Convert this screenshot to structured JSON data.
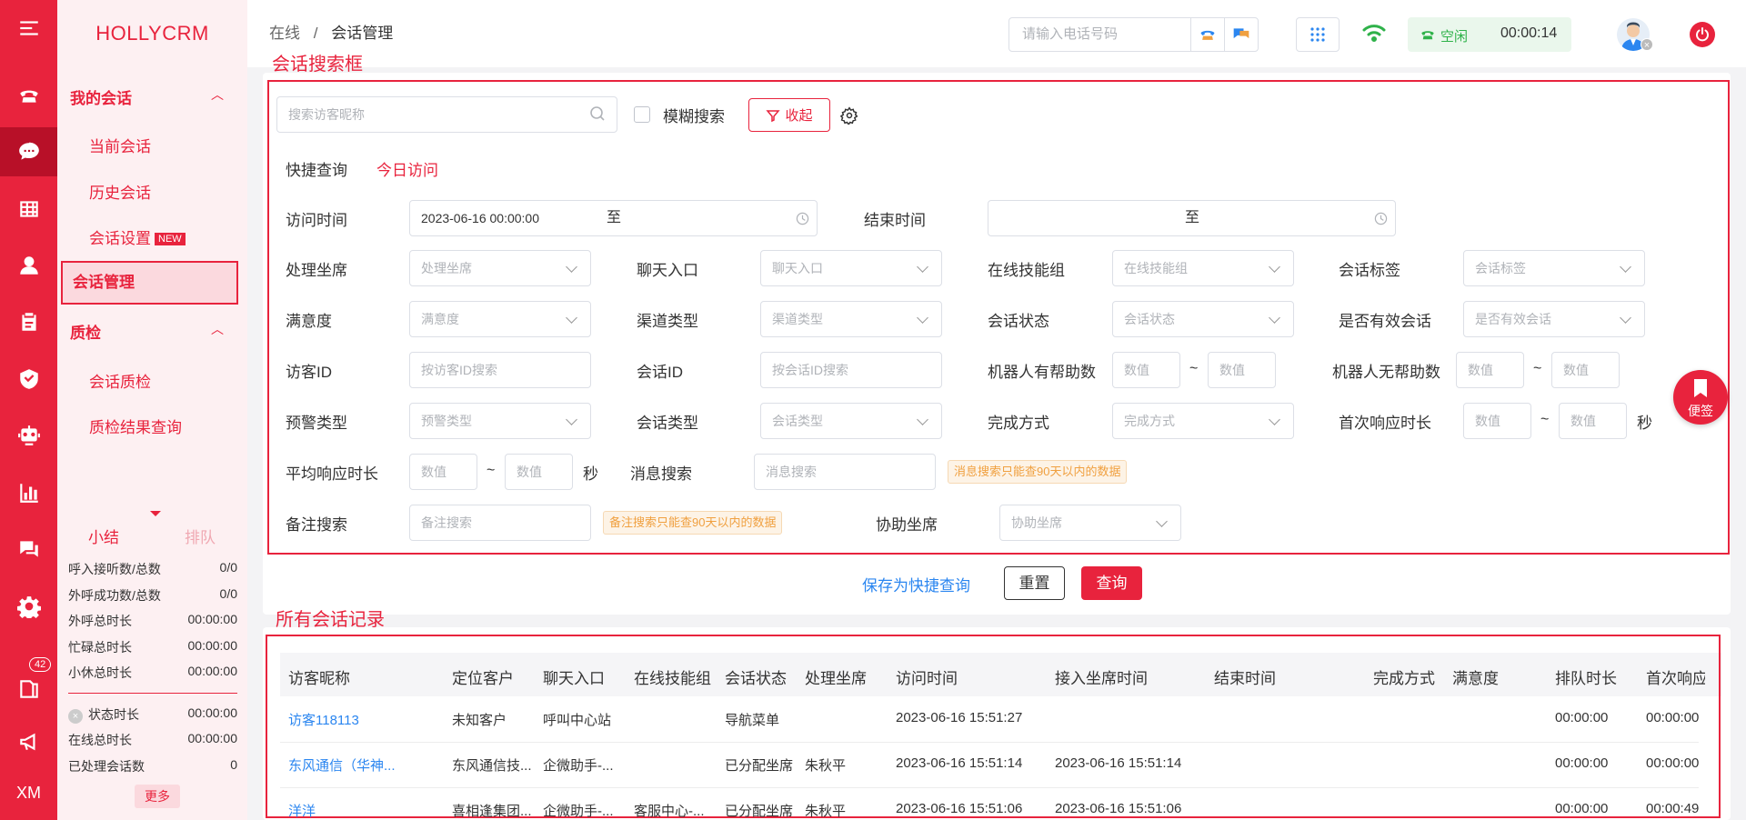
{
  "sidebar": {
    "logo": "HOLLYCRM",
    "group_my": "我的会话",
    "items_my": [
      "当前会话",
      "历史会话",
      "会话设置"
    ],
    "new_badge": "NEW",
    "active_item": "会话管理",
    "group_qc": "质检",
    "items_qc": [
      "会话质检",
      "质检结果查询"
    ],
    "tab_summary": "小结",
    "tab_queue": "排队",
    "stats": [
      {
        "label": "呼入接听数/总数",
        "value": "0/0"
      },
      {
        "label": "外呼成功数/总数",
        "value": "0/0"
      },
      {
        "label": "外呼总时长",
        "value": "00:00:00"
      },
      {
        "label": "忙碌总时长",
        "value": "00:00:00"
      },
      {
        "label": "小休总时长",
        "value": "00:00:00"
      }
    ],
    "stats2": [
      {
        "label": "状态时长",
        "value": "00:00:00"
      },
      {
        "label": "在线总时长",
        "value": "00:00:00"
      },
      {
        "label": "已处理会话数",
        "value": "0"
      }
    ],
    "more_label": "更多",
    "rail_badge": "42",
    "rail_text": "XM"
  },
  "topbar": {
    "breadcrumb_root": "在线",
    "breadcrumb_sep": "/",
    "breadcrumb_current": "会话管理",
    "phone_placeholder": "请输入电话号码",
    "status": "空闲",
    "timer": "00:00:14"
  },
  "annotations": {
    "search_box": "会话搜索框",
    "all_records": "所有会话记录"
  },
  "search": {
    "visitor_placeholder": "搜索访客昵称",
    "fuzzy_label": "模糊搜索",
    "collapse_label": "收起",
    "quick_label": "快捷查询",
    "quick_today": "今日访问",
    "visit_time_label": "访问时间",
    "visit_time_start": "2023-06-16 00:00:00",
    "to": "至",
    "end_time_label": "结束时间",
    "fields": [
      {
        "label": "处理坐席",
        "placeholder": "处理坐席"
      },
      {
        "label": "聊天入口",
        "placeholder": "聊天入口"
      },
      {
        "label": "在线技能组",
        "placeholder": "在线技能组"
      },
      {
        "label": "会话标签",
        "placeholder": "会话标签"
      },
      {
        "label": "满意度",
        "placeholder": "满意度"
      },
      {
        "label": "渠道类型",
        "placeholder": "渠道类型"
      },
      {
        "label": "会话状态",
        "placeholder": "会话状态"
      },
      {
        "label": "是否有效会话",
        "placeholder": "是否有效会话"
      },
      {
        "label": "访客ID",
        "placeholder": "按访客ID搜索"
      },
      {
        "label": "会话ID",
        "placeholder": "按会话ID搜索"
      },
      {
        "label": "预警类型",
        "placeholder": "预警类型"
      },
      {
        "label": "会话类型",
        "placeholder": "会话类型"
      },
      {
        "label": "完成方式",
        "placeholder": "完成方式"
      }
    ],
    "robot_help_label": "机器人有帮助数",
    "robot_nohelp_label": "机器人无帮助数",
    "first_resp_label": "首次响应时长",
    "avg_resp_label": "平均响应时长",
    "num_placeholder": "数值",
    "tilde": "~",
    "sec": "秒",
    "msg_search_label": "消息搜索",
    "msg_search_placeholder": "消息搜索",
    "msg_warn": "消息搜索只能查90天以内的数据",
    "remark_label": "备注搜索",
    "remark_placeholder": "备注搜索",
    "remark_warn": "备注搜索只能查90天以内的数据",
    "assist_label": "协助坐席",
    "assist_placeholder": "协助坐席",
    "save_quick": "保存为快捷查询",
    "reset": "重置",
    "query": "查询",
    "sticky_note": "便签"
  },
  "table": {
    "columns": [
      "访客昵称",
      "定位客户",
      "聊天入口",
      "在线技能组",
      "会话状态",
      "处理坐席",
      "访问时间",
      "接入坐席时间",
      "结束时间",
      "完成方式",
      "满意度",
      "排队时长",
      "首次响应"
    ],
    "rows": [
      [
        "访客118113",
        "未知客户",
        "呼叫中心站",
        "",
        "导航菜单",
        "",
        "2023-06-16 15:51:27",
        "",
        "",
        "",
        "",
        "00:00:00",
        "00:00:00"
      ],
      [
        "东风通信（华神...",
        "东风通信技...",
        "企微助手-...",
        "",
        "已分配坐席",
        "朱秋平",
        "2023-06-16 15:51:14",
        "2023-06-16 15:51:14",
        "",
        "",
        "",
        "00:00:00",
        "00:00:00"
      ],
      [
        "洋洋",
        "喜相逢集团...",
        "企微助手-...",
        "客服中心-...",
        "已分配坐席",
        "朱秋平",
        "2023-06-16 15:51:06",
        "2023-06-16 15:51:06",
        "",
        "",
        "",
        "00:00:00",
        "00:00:49"
      ]
    ]
  }
}
